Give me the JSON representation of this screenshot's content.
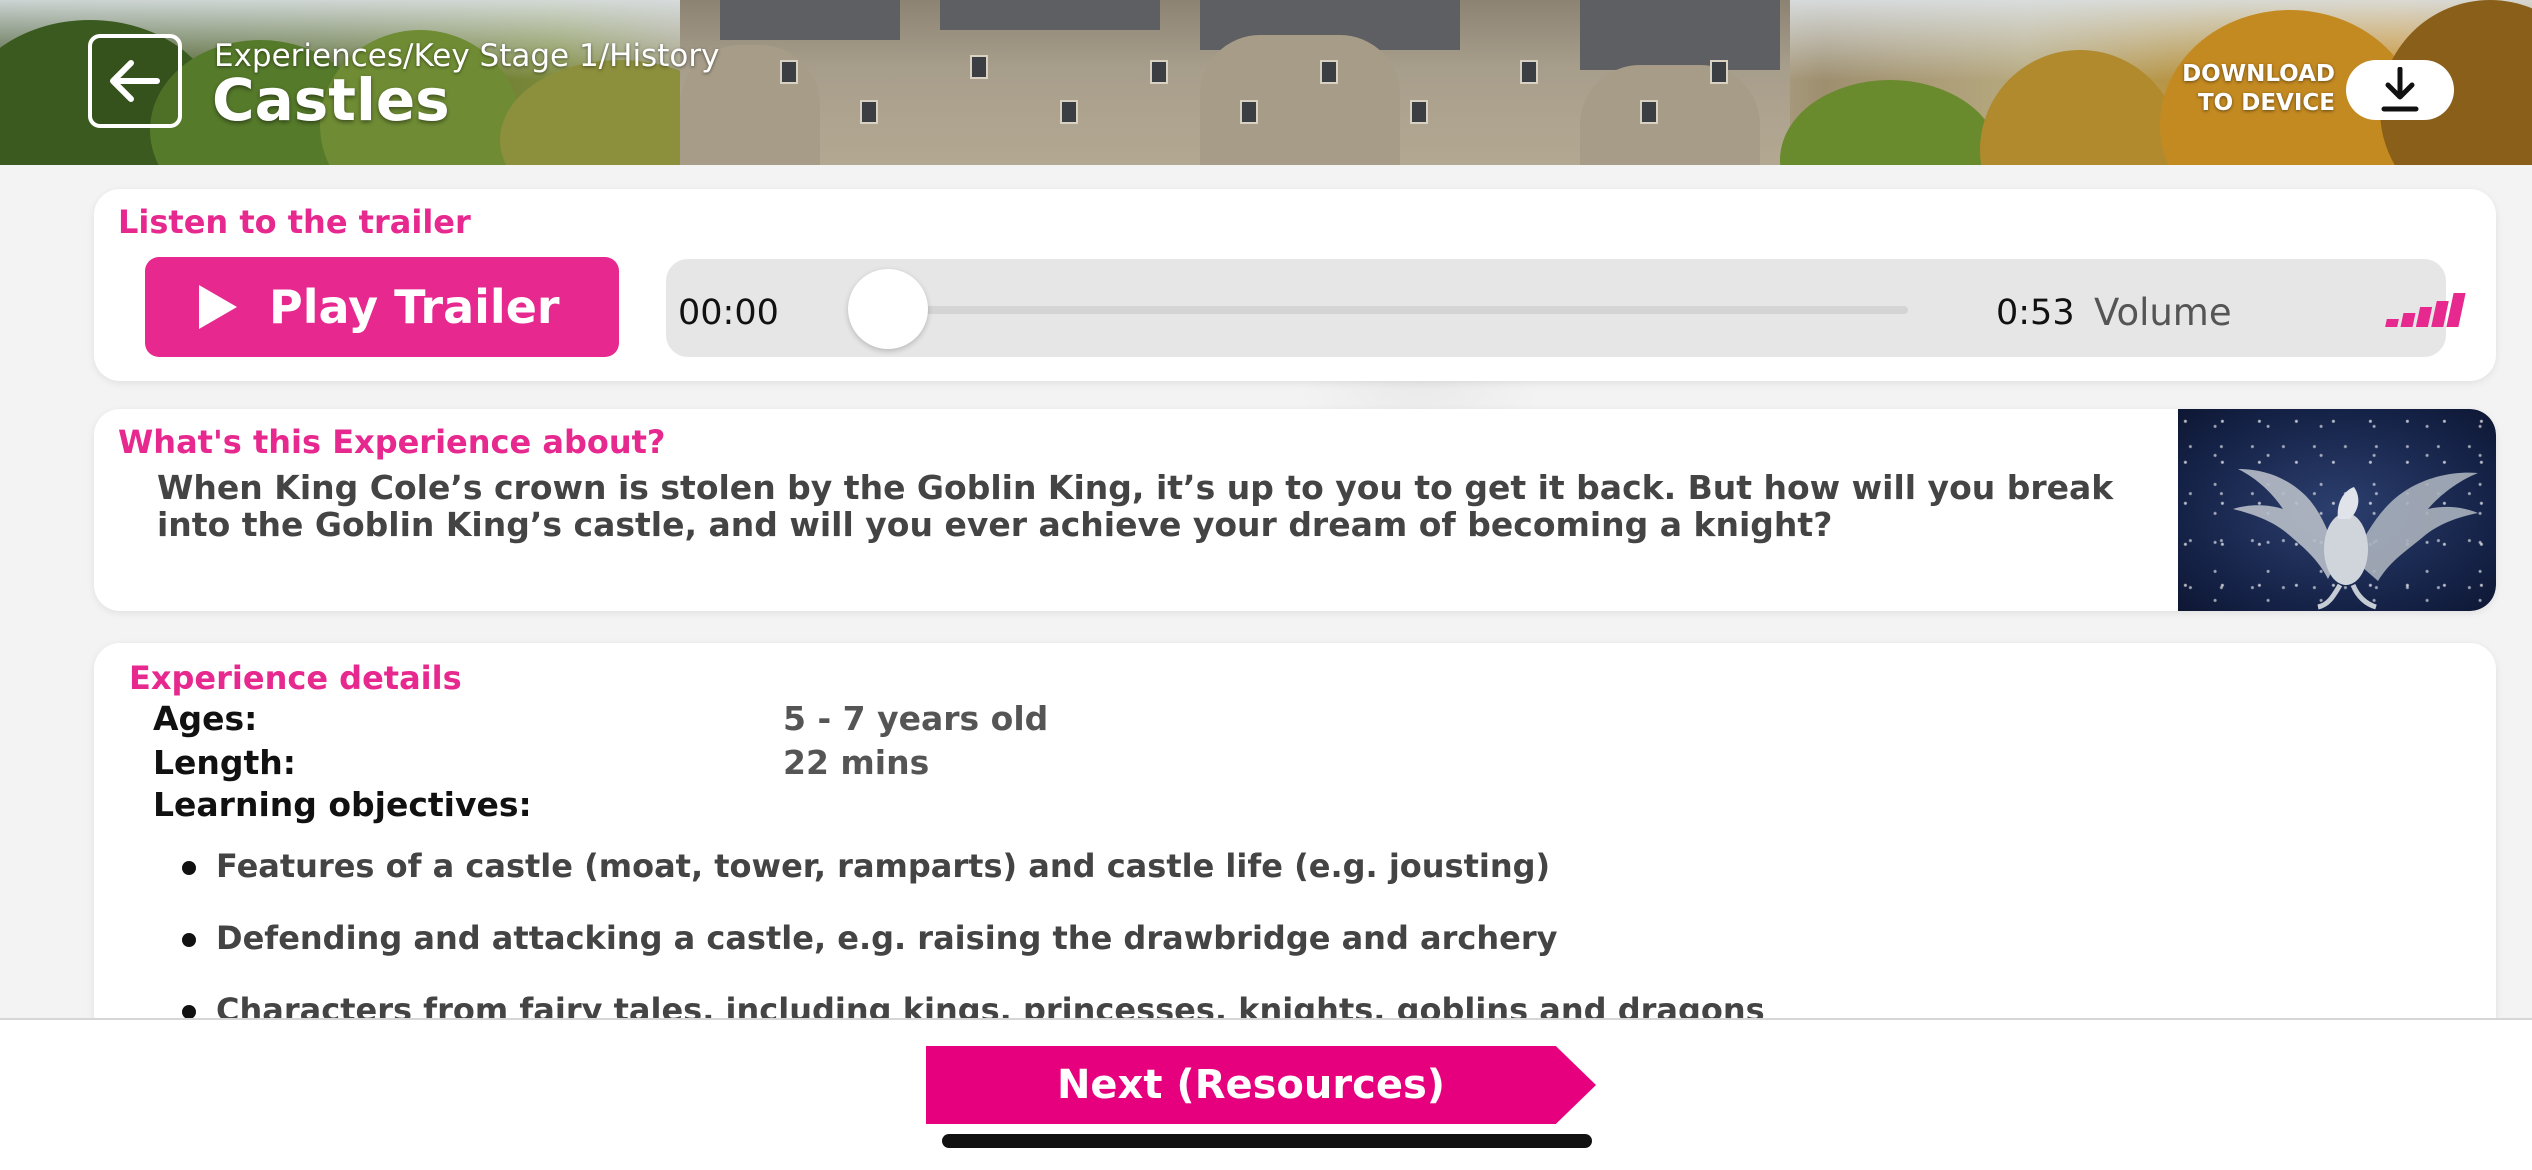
{
  "header": {
    "breadcrumb": "Experiences/Key Stage 1/History",
    "title": "Castles",
    "download_label": "DOWNLOAD TO DEVICE"
  },
  "trailer": {
    "heading": "Listen to the trailer",
    "play_label": "Play Trailer",
    "current_time": "00:00",
    "total_time": "0:53",
    "volume_label": "Volume",
    "progress": 0.0
  },
  "about": {
    "heading": "What's this Experience about?",
    "description": "When King Cole’s crown is stolen by the Goblin King, it’s up to you to get it back. But how will you break into the Goblin King’s castle, and will you ever achieve your dream of becoming a knight?"
  },
  "details": {
    "heading": "Experience details",
    "ages_label": "Ages:",
    "ages_value": "5 - 7 years old",
    "length_label": "Length:",
    "length_value": "22 mins",
    "objectives_label": "Learning objectives:",
    "objectives": [
      "Features of a castle (moat, tower, ramparts) and castle life (e.g. jousting)",
      "Defending and attacking a castle, e.g. raising the drawbridge and archery",
      "Characters from fairy tales, including kings, princesses, knights, goblins and dragons"
    ]
  },
  "footer": {
    "next_label": "Next (Resources)"
  },
  "colors": {
    "accent": "#e6288f",
    "next_button": "#e6007e"
  },
  "icons": {
    "back": "arrow-left-icon",
    "download": "download-icon",
    "play": "play-icon",
    "volume": "volume-bars-icon"
  }
}
